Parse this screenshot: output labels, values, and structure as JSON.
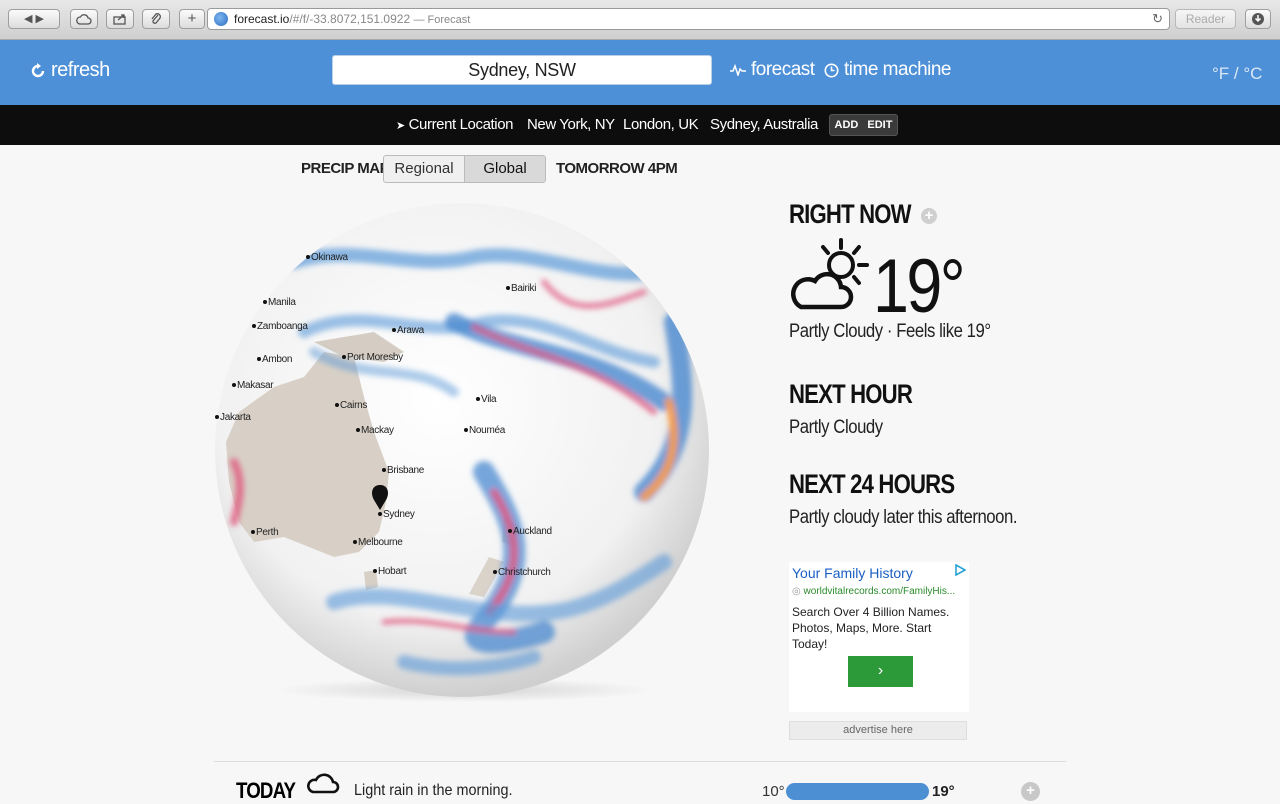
{
  "browser": {
    "url_host": "forecast.io",
    "url_path": "/#/f/-33.8072,151.0922",
    "page_title": "— Forecast",
    "reader_label": "Reader"
  },
  "header": {
    "refresh_label": "refresh",
    "search_value": "Sydney, NSW",
    "forecast_label": "forecast",
    "time_machine_label": "time machine",
    "units_label": "°F / °C"
  },
  "locations": {
    "current": "Current Location",
    "items": [
      "New York, NY",
      "London, UK",
      "Sydney, Australia"
    ],
    "add_label": "ADD",
    "edit_label": "EDIT"
  },
  "precip_map": {
    "label": "PRECIP MAP",
    "options": [
      "Regional",
      "Global"
    ],
    "selected": "Global",
    "time_label": "TOMORROW 4PM",
    "cities": [
      "Okinawa",
      "Bairiki",
      "Manila",
      "Zamboanga",
      "Arawa",
      "Ambon",
      "Port Moresby",
      "Makasar",
      "Vila",
      "Cairns",
      "Jakarta",
      "Mackay",
      "Nouméa",
      "Brisbane",
      "Sydney",
      "Auckland",
      "Perth",
      "Melbourne",
      "Hobart",
      "Christchurch"
    ]
  },
  "right_now": {
    "heading": "RIGHT NOW",
    "temperature": "19°",
    "summary": "Partly Cloudy · Feels like 19°"
  },
  "next_hour": {
    "heading": "NEXT HOUR",
    "summary": "Partly Cloudy"
  },
  "next_24": {
    "heading": "NEXT 24 HOURS",
    "summary": "Partly cloudy later this afternoon."
  },
  "ad": {
    "title": "Your Family History",
    "url": "worldvitalrecords.com/FamilyHis...",
    "body": "Search Over 4 Billion Names. Photos, Maps, More. Start Today!",
    "advertise_label": "advertise here"
  },
  "today": {
    "label": "TODAY",
    "summary": "Light rain in the morning.",
    "low": "10°",
    "high": "19°"
  }
}
